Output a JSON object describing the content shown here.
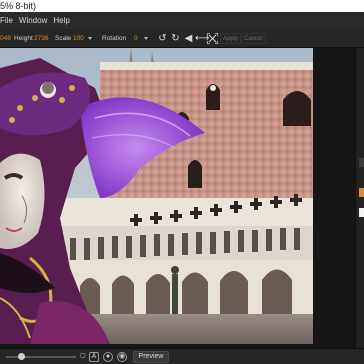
{
  "window": {
    "title_fragment": "5% 8-bit)"
  },
  "menu": {
    "items": [
      "File",
      "Window",
      "Help"
    ]
  },
  "toolbar": {
    "width_value": "048",
    "height_label": "Height",
    "height_value": "2736",
    "scale_label": "Scale",
    "scale_value": "100",
    "rotation_label": "Rotation",
    "rotation_value": "0",
    "apply_label": "Apply",
    "cancel_label": "Cancel"
  },
  "bottom": {
    "preview_label": "Preview"
  },
  "colors": {
    "accent": "#e08a2b",
    "panel": "#262626",
    "canvas": "#161616"
  },
  "icons": [
    "rotate-ccw-icon",
    "rotate-cw-icon",
    "flip-horizontal-icon",
    "flip-vertical-icon",
    "fit-screen-icon",
    "zoom-thumb-icon",
    "text-mode-icon",
    "mask-icon",
    "target-icon"
  ]
}
